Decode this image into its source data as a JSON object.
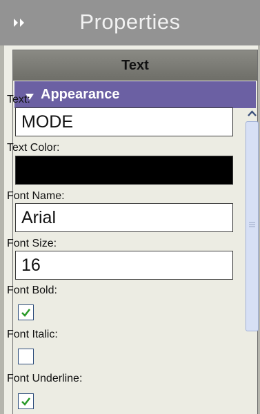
{
  "header": {
    "title": "Properties",
    "collapse_icon": "double-chevron-right-icon"
  },
  "tab": {
    "label": "Text"
  },
  "section": {
    "label": "Appearance",
    "expanded": true,
    "accent_color": "#6b60a3"
  },
  "properties": {
    "text": {
      "label": "Text:",
      "value": "MODE"
    },
    "text_color": {
      "label": "Text Color:",
      "value": "#000000"
    },
    "font_name": {
      "label": "Font Name:",
      "value": "Arial"
    },
    "font_size": {
      "label": "Font Size:",
      "value": "16"
    },
    "font_bold": {
      "label": "Font Bold:",
      "checked": true
    },
    "font_italic": {
      "label": "Font Italic:",
      "checked": false
    },
    "font_underline": {
      "label": "Font Underline:",
      "checked": true
    }
  }
}
